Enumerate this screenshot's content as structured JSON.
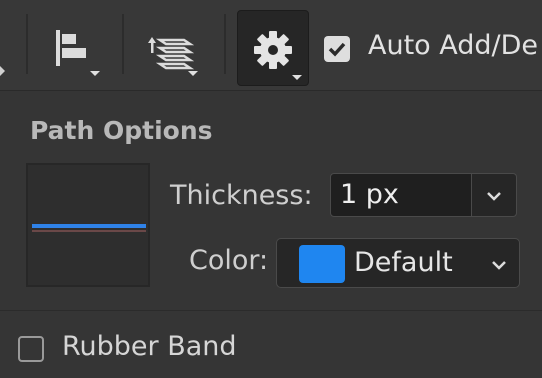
{
  "toolbar": {
    "tools": [
      {
        "name": "align-icon",
        "has_menu": true
      },
      {
        "name": "path-arrangement-icon",
        "has_menu": true
      },
      {
        "name": "gear-icon",
        "has_menu": true,
        "active": true
      }
    ],
    "auto_add_delete": {
      "label": "Auto Add/De",
      "checked": true
    }
  },
  "path_options": {
    "title": "Path Options",
    "preview_color": "#2f82e8",
    "thickness": {
      "label": "Thickness:",
      "value": "1 px"
    },
    "color": {
      "label": "Color:",
      "value": "Default",
      "swatch": "#1f86f0"
    }
  },
  "rubber_band": {
    "label": "Rubber Band",
    "checked": false
  }
}
